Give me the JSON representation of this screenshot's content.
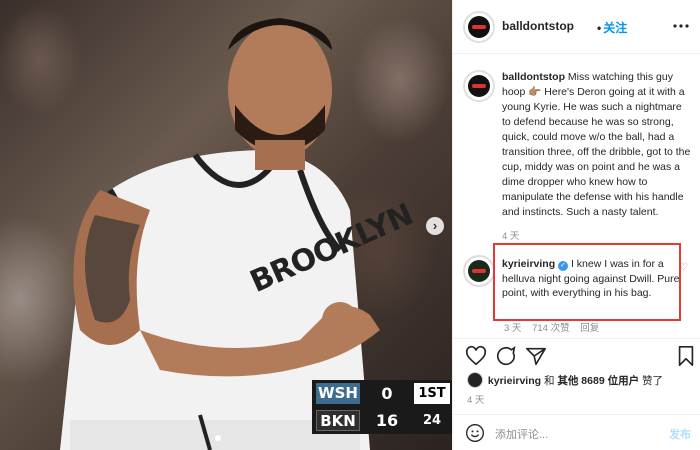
{
  "post": {
    "username": "balldontstop",
    "follow_label": "关注",
    "follow_separator": "•",
    "more_icon": "more-icon"
  },
  "caption": {
    "username": "balldontstop",
    "text": "Miss watching this guy hoop 👉🏽 Here's Deron going at it with a young Kyrie. He was such a nightmare to defend because he was so strong, quick, could move w/o the ball, had a transition three, off the dribble, got to the cup, middy was on point and he was a dime dropper who knew how to manipulate the defense with his handle and instincts. Such a nasty talent.",
    "time": "4 天"
  },
  "comment": {
    "username": "kyrieirving",
    "text": "I knew I was in for a helluva night going against Dwill. Pure point, with everything in his bag.",
    "time": "3 天",
    "likes": "714 次赞",
    "reply": "回复",
    "highlight_color": "#e53935"
  },
  "likes": {
    "user": "kyrieirving",
    "and": "和",
    "others": "其他 8689 位用户",
    "suffix": "赞了"
  },
  "post_time": "4 天",
  "add_comment": {
    "placeholder": "添加评论...",
    "post_label": "发布"
  },
  "scoreboard": {
    "rows": [
      {
        "team": "WSH",
        "score": "0",
        "extra": "1ST"
      },
      {
        "team": "BKN",
        "score": "16",
        "extra": "24"
      }
    ]
  },
  "jersey_text": "BROOKLYN",
  "colors": {
    "accent": "#0095f6",
    "text": "#262626",
    "muted": "#8e8e8e",
    "wsh_blue": "#3d6d8e"
  }
}
